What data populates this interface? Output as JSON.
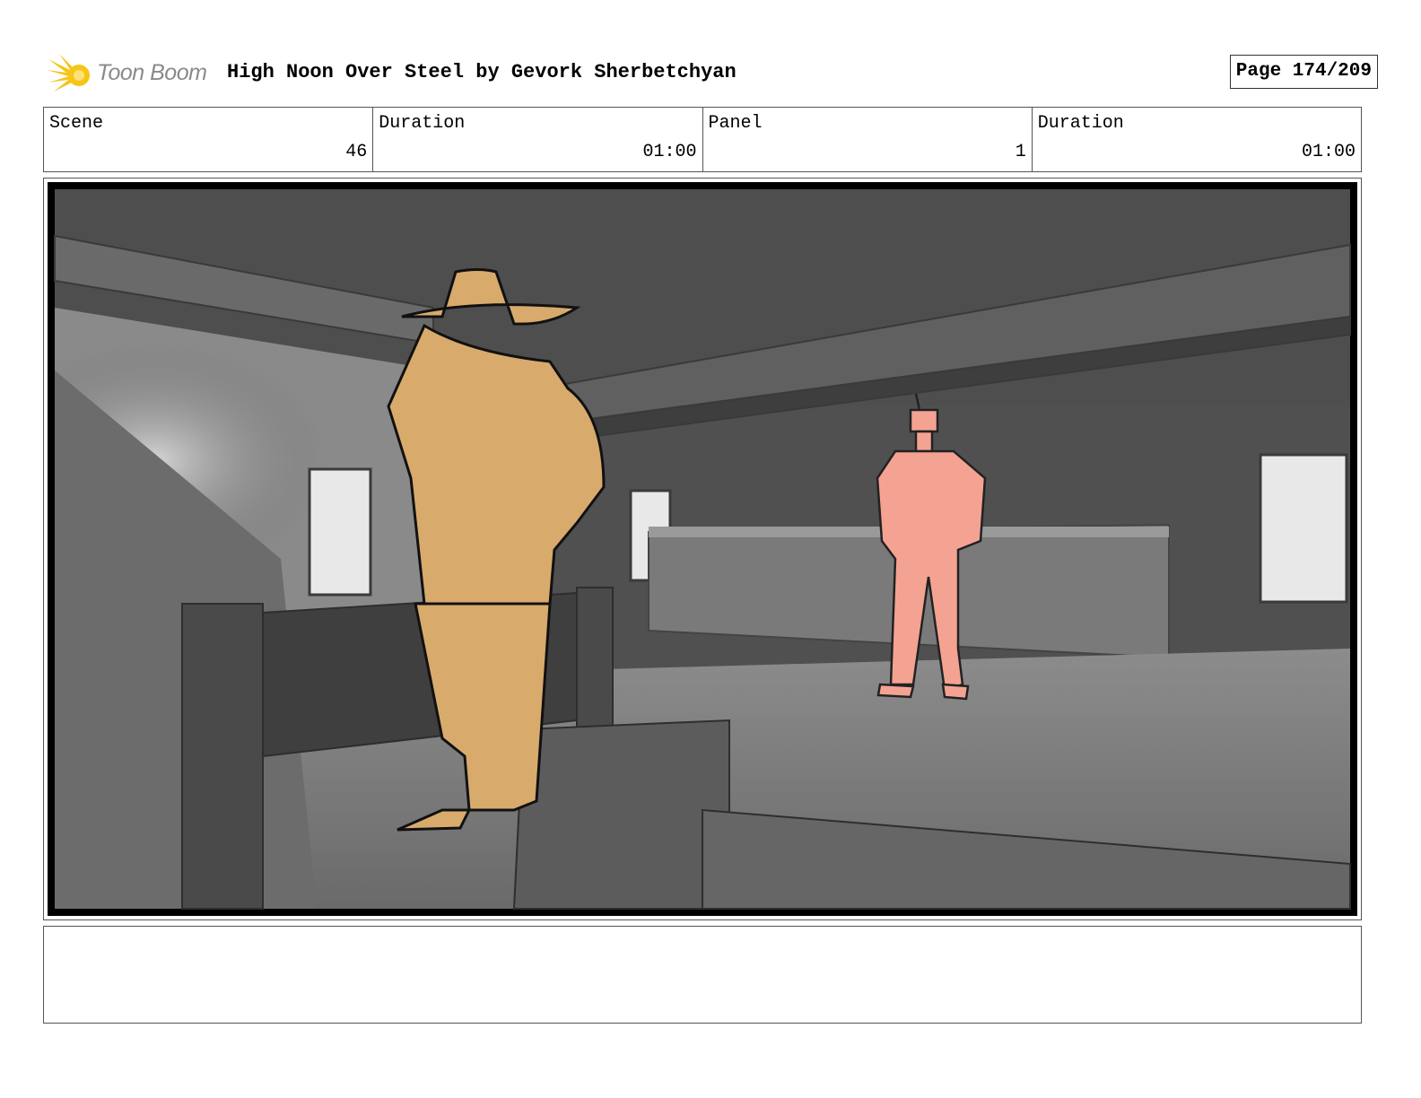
{
  "brand": {
    "logo_text": "Toon Boom",
    "logo_color": "#f5c518",
    "logo_icon": "starburst-icon"
  },
  "document": {
    "title": "High Noon Over Steel by Gevork Sherbetchyan",
    "page": "Page 174/209"
  },
  "info": {
    "scene_label": "Scene",
    "scene_value": "46",
    "scene_duration_label": "Duration",
    "scene_duration_value": "01:00",
    "panel_label": "Panel",
    "panel_value": "1",
    "panel_duration_label": "Duration",
    "panel_duration_value": "01:00"
  },
  "colors": {
    "cowboy_fill": "#d8aa6c",
    "robot_fill": "#f4a392",
    "set_gray": "#707070"
  },
  "notes": {
    "text": ""
  }
}
